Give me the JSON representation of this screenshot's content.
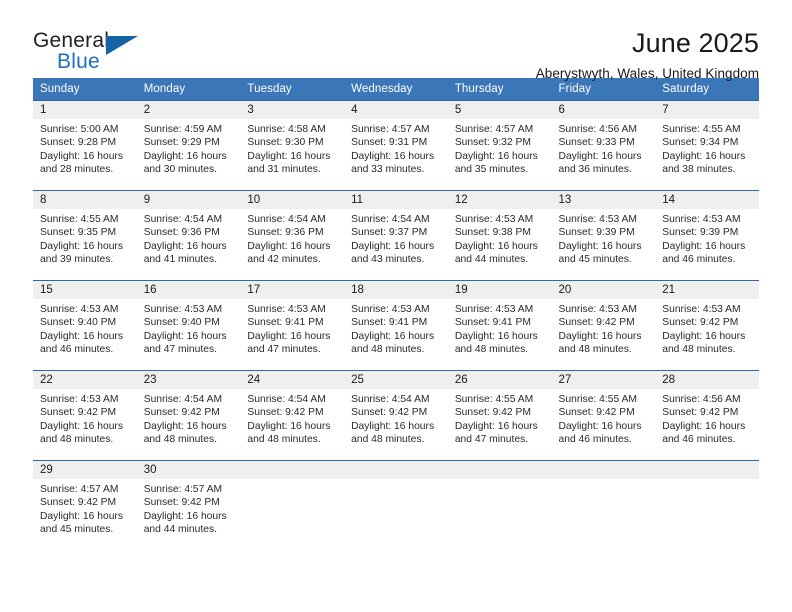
{
  "brand": {
    "line1": "General",
    "line2": "Blue",
    "triangle_color": "#1464a5"
  },
  "header": {
    "title": "June 2025",
    "subtitle": "Aberystwyth, Wales, United Kingdom"
  },
  "theme": {
    "header_row_bg": "#3b76b8",
    "cell_border": "#2f6aa8",
    "daynum_bg": "#efefef"
  },
  "weekday_headers": [
    "Sunday",
    "Monday",
    "Tuesday",
    "Wednesday",
    "Thursday",
    "Friday",
    "Saturday"
  ],
  "weeks": [
    [
      {
        "day": "1",
        "sunrise": "Sunrise: 5:00 AM",
        "sunset": "Sunset: 9:28 PM",
        "daylight1": "Daylight: 16 hours",
        "daylight2": "and 28 minutes."
      },
      {
        "day": "2",
        "sunrise": "Sunrise: 4:59 AM",
        "sunset": "Sunset: 9:29 PM",
        "daylight1": "Daylight: 16 hours",
        "daylight2": "and 30 minutes."
      },
      {
        "day": "3",
        "sunrise": "Sunrise: 4:58 AM",
        "sunset": "Sunset: 9:30 PM",
        "daylight1": "Daylight: 16 hours",
        "daylight2": "and 31 minutes."
      },
      {
        "day": "4",
        "sunrise": "Sunrise: 4:57 AM",
        "sunset": "Sunset: 9:31 PM",
        "daylight1": "Daylight: 16 hours",
        "daylight2": "and 33 minutes."
      },
      {
        "day": "5",
        "sunrise": "Sunrise: 4:57 AM",
        "sunset": "Sunset: 9:32 PM",
        "daylight1": "Daylight: 16 hours",
        "daylight2": "and 35 minutes."
      },
      {
        "day": "6",
        "sunrise": "Sunrise: 4:56 AM",
        "sunset": "Sunset: 9:33 PM",
        "daylight1": "Daylight: 16 hours",
        "daylight2": "and 36 minutes."
      },
      {
        "day": "7",
        "sunrise": "Sunrise: 4:55 AM",
        "sunset": "Sunset: 9:34 PM",
        "daylight1": "Daylight: 16 hours",
        "daylight2": "and 38 minutes."
      }
    ],
    [
      {
        "day": "8",
        "sunrise": "Sunrise: 4:55 AM",
        "sunset": "Sunset: 9:35 PM",
        "daylight1": "Daylight: 16 hours",
        "daylight2": "and 39 minutes."
      },
      {
        "day": "9",
        "sunrise": "Sunrise: 4:54 AM",
        "sunset": "Sunset: 9:36 PM",
        "daylight1": "Daylight: 16 hours",
        "daylight2": "and 41 minutes."
      },
      {
        "day": "10",
        "sunrise": "Sunrise: 4:54 AM",
        "sunset": "Sunset: 9:36 PM",
        "daylight1": "Daylight: 16 hours",
        "daylight2": "and 42 minutes."
      },
      {
        "day": "11",
        "sunrise": "Sunrise: 4:54 AM",
        "sunset": "Sunset: 9:37 PM",
        "daylight1": "Daylight: 16 hours",
        "daylight2": "and 43 minutes."
      },
      {
        "day": "12",
        "sunrise": "Sunrise: 4:53 AM",
        "sunset": "Sunset: 9:38 PM",
        "daylight1": "Daylight: 16 hours",
        "daylight2": "and 44 minutes."
      },
      {
        "day": "13",
        "sunrise": "Sunrise: 4:53 AM",
        "sunset": "Sunset: 9:39 PM",
        "daylight1": "Daylight: 16 hours",
        "daylight2": "and 45 minutes."
      },
      {
        "day": "14",
        "sunrise": "Sunrise: 4:53 AM",
        "sunset": "Sunset: 9:39 PM",
        "daylight1": "Daylight: 16 hours",
        "daylight2": "and 46 minutes."
      }
    ],
    [
      {
        "day": "15",
        "sunrise": "Sunrise: 4:53 AM",
        "sunset": "Sunset: 9:40 PM",
        "daylight1": "Daylight: 16 hours",
        "daylight2": "and 46 minutes."
      },
      {
        "day": "16",
        "sunrise": "Sunrise: 4:53 AM",
        "sunset": "Sunset: 9:40 PM",
        "daylight1": "Daylight: 16 hours",
        "daylight2": "and 47 minutes."
      },
      {
        "day": "17",
        "sunrise": "Sunrise: 4:53 AM",
        "sunset": "Sunset: 9:41 PM",
        "daylight1": "Daylight: 16 hours",
        "daylight2": "and 47 minutes."
      },
      {
        "day": "18",
        "sunrise": "Sunrise: 4:53 AM",
        "sunset": "Sunset: 9:41 PM",
        "daylight1": "Daylight: 16 hours",
        "daylight2": "and 48 minutes."
      },
      {
        "day": "19",
        "sunrise": "Sunrise: 4:53 AM",
        "sunset": "Sunset: 9:41 PM",
        "daylight1": "Daylight: 16 hours",
        "daylight2": "and 48 minutes."
      },
      {
        "day": "20",
        "sunrise": "Sunrise: 4:53 AM",
        "sunset": "Sunset: 9:42 PM",
        "daylight1": "Daylight: 16 hours",
        "daylight2": "and 48 minutes."
      },
      {
        "day": "21",
        "sunrise": "Sunrise: 4:53 AM",
        "sunset": "Sunset: 9:42 PM",
        "daylight1": "Daylight: 16 hours",
        "daylight2": "and 48 minutes."
      }
    ],
    [
      {
        "day": "22",
        "sunrise": "Sunrise: 4:53 AM",
        "sunset": "Sunset: 9:42 PM",
        "daylight1": "Daylight: 16 hours",
        "daylight2": "and 48 minutes."
      },
      {
        "day": "23",
        "sunrise": "Sunrise: 4:54 AM",
        "sunset": "Sunset: 9:42 PM",
        "daylight1": "Daylight: 16 hours",
        "daylight2": "and 48 minutes."
      },
      {
        "day": "24",
        "sunrise": "Sunrise: 4:54 AM",
        "sunset": "Sunset: 9:42 PM",
        "daylight1": "Daylight: 16 hours",
        "daylight2": "and 48 minutes."
      },
      {
        "day": "25",
        "sunrise": "Sunrise: 4:54 AM",
        "sunset": "Sunset: 9:42 PM",
        "daylight1": "Daylight: 16 hours",
        "daylight2": "and 48 minutes."
      },
      {
        "day": "26",
        "sunrise": "Sunrise: 4:55 AM",
        "sunset": "Sunset: 9:42 PM",
        "daylight1": "Daylight: 16 hours",
        "daylight2": "and 47 minutes."
      },
      {
        "day": "27",
        "sunrise": "Sunrise: 4:55 AM",
        "sunset": "Sunset: 9:42 PM",
        "daylight1": "Daylight: 16 hours",
        "daylight2": "and 46 minutes."
      },
      {
        "day": "28",
        "sunrise": "Sunrise: 4:56 AM",
        "sunset": "Sunset: 9:42 PM",
        "daylight1": "Daylight: 16 hours",
        "daylight2": "and 46 minutes."
      }
    ],
    [
      {
        "day": "29",
        "sunrise": "Sunrise: 4:57 AM",
        "sunset": "Sunset: 9:42 PM",
        "daylight1": "Daylight: 16 hours",
        "daylight2": "and 45 minutes."
      },
      {
        "day": "30",
        "sunrise": "Sunrise: 4:57 AM",
        "sunset": "Sunset: 9:42 PM",
        "daylight1": "Daylight: 16 hours",
        "daylight2": "and 44 minutes."
      },
      {
        "day": "",
        "sunrise": "",
        "sunset": "",
        "daylight1": "",
        "daylight2": ""
      },
      {
        "day": "",
        "sunrise": "",
        "sunset": "",
        "daylight1": "",
        "daylight2": ""
      },
      {
        "day": "",
        "sunrise": "",
        "sunset": "",
        "daylight1": "",
        "daylight2": ""
      },
      {
        "day": "",
        "sunrise": "",
        "sunset": "",
        "daylight1": "",
        "daylight2": ""
      },
      {
        "day": "",
        "sunrise": "",
        "sunset": "",
        "daylight1": "",
        "daylight2": ""
      }
    ]
  ]
}
